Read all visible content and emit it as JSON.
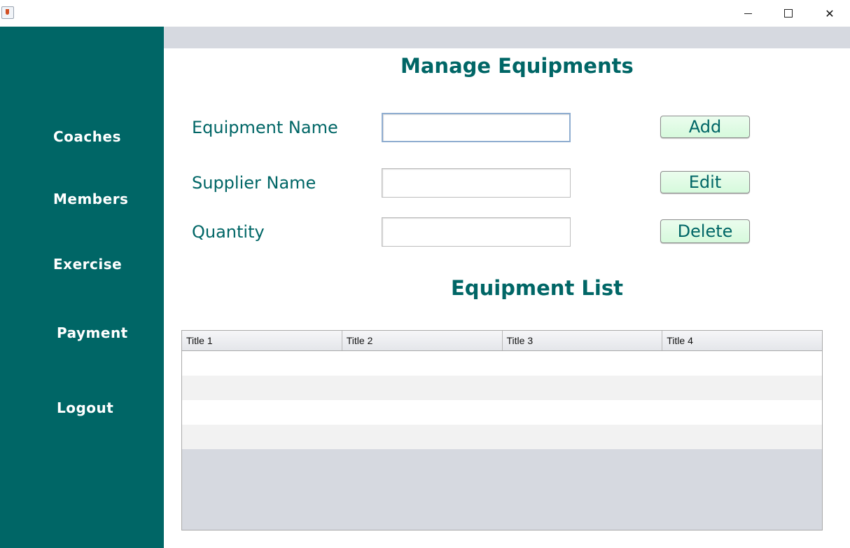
{
  "window": {
    "min_icon": "minimize-icon",
    "max_icon": "maximize-icon",
    "close_glyph": "✕"
  },
  "sidebar": {
    "items": [
      {
        "label": "Coaches"
      },
      {
        "label": "Members"
      },
      {
        "label": "Exercise"
      },
      {
        "label": "Payment"
      },
      {
        "label": "Logout"
      }
    ]
  },
  "main": {
    "title": "Manage Equipments",
    "form": {
      "equipment_name_label": "Equipment Name",
      "supplier_name_label": "Supplier Name",
      "quantity_label": "Quantity",
      "equipment_name_value": "",
      "supplier_name_value": "",
      "quantity_value": ""
    },
    "buttons": {
      "add": "Add",
      "edit": "Edit",
      "delete": "Delete"
    },
    "list_title": "Equipment List",
    "table": {
      "columns": [
        "Title 1",
        "Title 2",
        "Title 3",
        "Title 4"
      ],
      "rows": [
        [
          "",
          "",
          "",
          ""
        ],
        [
          "",
          "",
          "",
          ""
        ],
        [
          "",
          "",
          "",
          ""
        ],
        [
          "",
          "",
          "",
          ""
        ]
      ]
    }
  },
  "colors": {
    "brand": "#006666",
    "button_bg": "#d6f9dc",
    "band": "#d6d9e0"
  }
}
